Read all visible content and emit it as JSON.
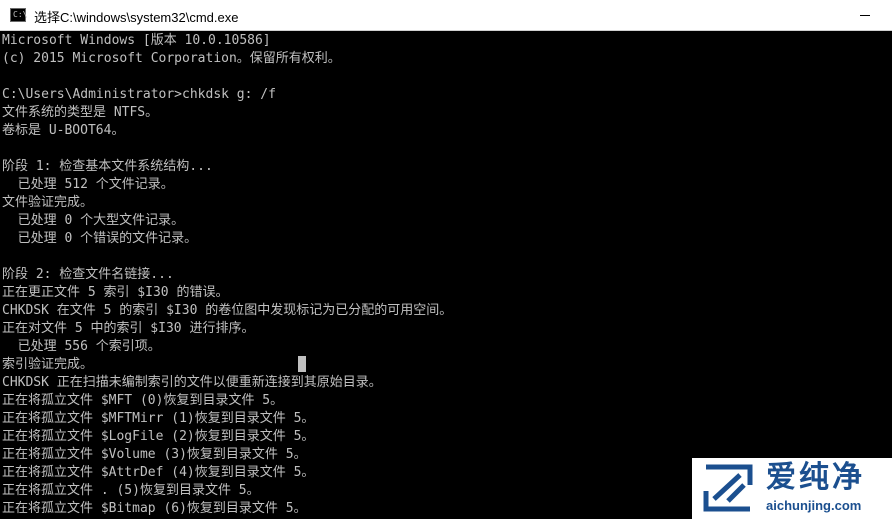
{
  "window": {
    "title": "选择C:\\windows\\system32\\cmd.exe",
    "icon": "cmd-console-icon",
    "icon_label": "C:\\"
  },
  "console": {
    "lines": [
      "Microsoft Windows [版本 10.0.10586]",
      "(c) 2015 Microsoft Corporation。保留所有权利。",
      "",
      "C:\\Users\\Administrator>chkdsk g: /f",
      "文件系统的类型是 NTFS。",
      "卷标是 U-BOOT64。",
      "",
      "阶段 1: 检查基本文件系统结构...",
      "  已处理 512 个文件记录。",
      "文件验证完成。",
      "  已处理 0 个大型文件记录。",
      "  已处理 0 个错误的文件记录。",
      "",
      "阶段 2: 检查文件名链接...",
      "正在更正文件 5 索引 $I30 的错误。",
      "CHKDSK 在文件 5 的索引 $I30 的卷位图中发现标记为已分配的可用空间。",
      "正在对文件 5 中的索引 $I30 进行排序。",
      "  已处理 556 个索引项。",
      "索引验证完成。",
      "CHKDSK 正在扫描未编制索引的文件以便重新连接到其原始目录。",
      "正在将孤立文件 $MFT (0)恢复到目录文件 5。",
      "正在将孤立文件 $MFTMirr (1)恢复到目录文件 5。",
      "正在将孤立文件 $LogFile (2)恢复到目录文件 5。",
      "正在将孤立文件 $Volume (3)恢复到目录文件 5。",
      "正在将孤立文件 $AttrDef (4)恢复到目录文件 5。",
      "正在将孤立文件 . (5)恢复到目录文件 5。",
      "正在将孤立文件 $Bitmap (6)恢复到目录文件 5。"
    ]
  },
  "watermark": {
    "brand": "爱纯净",
    "url": "aichunjing.com"
  },
  "colors": {
    "console_bg": "#000000",
    "console_text": "#c0c0c0",
    "titlebar_bg": "#ffffff",
    "watermark_blue": "#1b4f8f"
  }
}
